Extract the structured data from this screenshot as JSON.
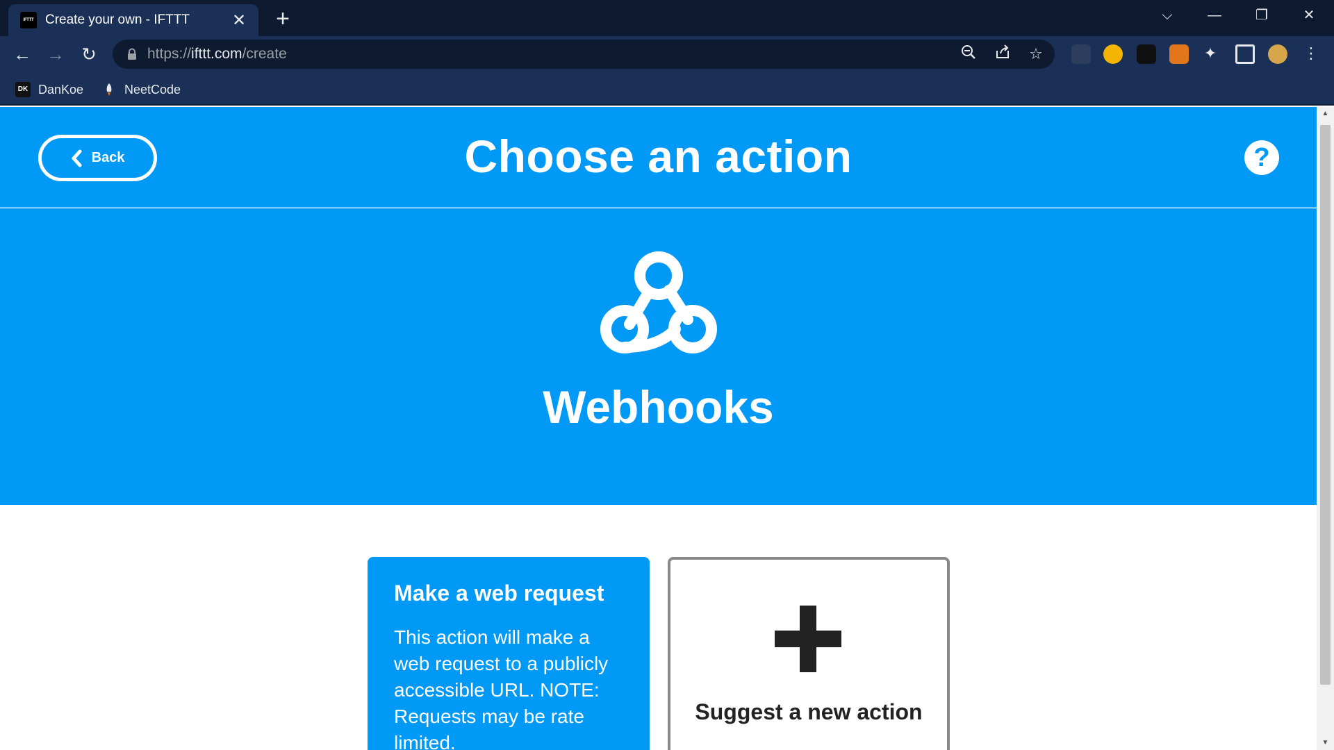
{
  "browser": {
    "tab_title": "Create your own - IFTTT",
    "tab_favicon_text": "IFTTT",
    "url_scheme": "https://",
    "url_host": "ifttt.com",
    "url_path": "/create",
    "bookmarks": [
      {
        "label": "DanKoe",
        "icon_text": "DK"
      },
      {
        "label": "NeetCode"
      }
    ],
    "colors": {
      "tabbar": "#0d1a2f",
      "toolbar": "#1b3056"
    }
  },
  "header": {
    "back_label": "Back",
    "title": "Choose an action",
    "help_icon": "?"
  },
  "service": {
    "name": "Webhooks",
    "icon": "webhooks-icon",
    "brand_color": "#0099f5"
  },
  "cards": [
    {
      "title": "Make a web request",
      "description": "This action will make a web request to a publicly accessible URL. NOTE: Requests may be rate limited."
    },
    {
      "label": "Suggest a new action",
      "icon": "plus-icon"
    }
  ]
}
